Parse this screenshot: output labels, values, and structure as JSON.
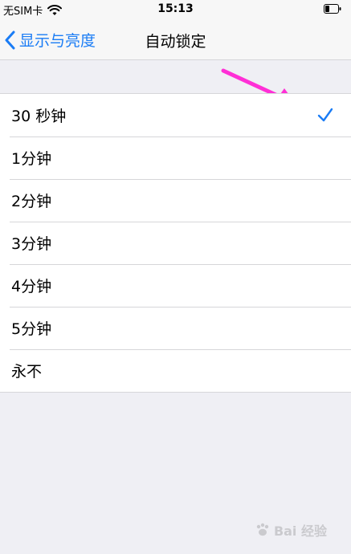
{
  "status_bar": {
    "carrier": "无SIM卡",
    "time": "15:13",
    "icons": [
      "wifi-icon",
      "battery-icon"
    ]
  },
  "nav": {
    "back_label": "显示与亮度",
    "title": "自动锁定",
    "accent_color": "#1a7cf5"
  },
  "options": [
    {
      "label": "30 秒钟",
      "selected": true
    },
    {
      "label": "1分钟",
      "selected": false
    },
    {
      "label": "2分钟",
      "selected": false
    },
    {
      "label": "3分钟",
      "selected": false
    },
    {
      "label": "4分钟",
      "selected": false
    },
    {
      "label": "5分钟",
      "selected": false
    },
    {
      "label": "永不",
      "selected": false
    }
  ],
  "annotation": {
    "color": "#ff2fd6"
  },
  "watermark": {
    "text": "Bai 经验"
  }
}
